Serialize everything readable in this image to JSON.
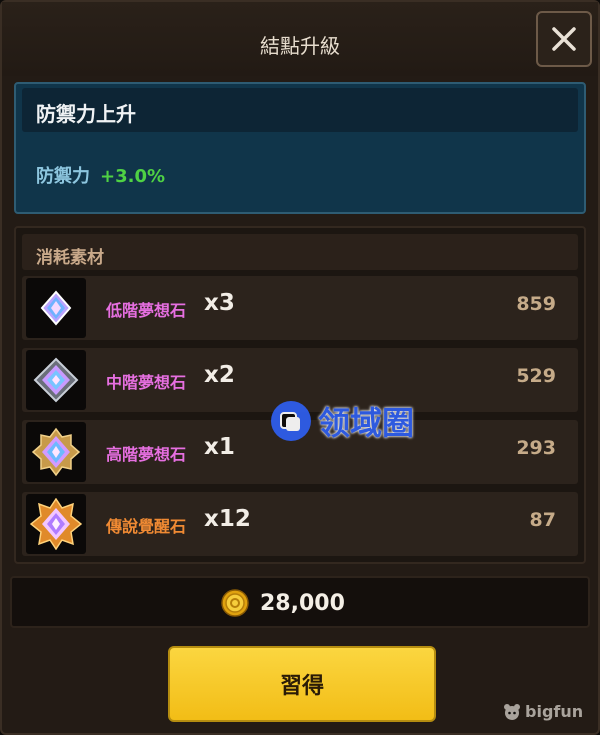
{
  "dialog": {
    "title": "結點升級",
    "close_icon": "close-icon"
  },
  "stat": {
    "title": "防禦力上升",
    "name": "防禦力",
    "value": "+3.0%"
  },
  "materials": {
    "title": "消耗素材",
    "items": [
      {
        "name": "低階夢想石",
        "qty": "x3",
        "owned": "859",
        "color": "#e66fe0",
        "icon": "low-dream-stone-icon"
      },
      {
        "name": "中階夢想石",
        "qty": "x2",
        "owned": "529",
        "color": "#e66fe0",
        "icon": "mid-dream-stone-icon"
      },
      {
        "name": "高階夢想石",
        "qty": "x1",
        "owned": "293",
        "color": "#e66fe0",
        "icon": "high-dream-stone-icon"
      },
      {
        "name": "傳說覺醒石",
        "qty": "x12",
        "owned": "87",
        "color": "#f08a33",
        "icon": "legend-awaken-stone-icon"
      }
    ]
  },
  "cost": {
    "icon": "gold-coin-icon",
    "value": "28,000"
  },
  "button": {
    "label": "習得"
  },
  "watermark": {
    "text": "领域圈",
    "icon": "lingyuquan-logo-icon"
  },
  "brand": {
    "text": "bigfun",
    "icon": "bigfun-logo-icon"
  },
  "colors": {
    "panel": "#231b15",
    "stat_bg": "#10354a",
    "stat_positive": "#4fd244",
    "button_yellow": "#f7c92a"
  }
}
